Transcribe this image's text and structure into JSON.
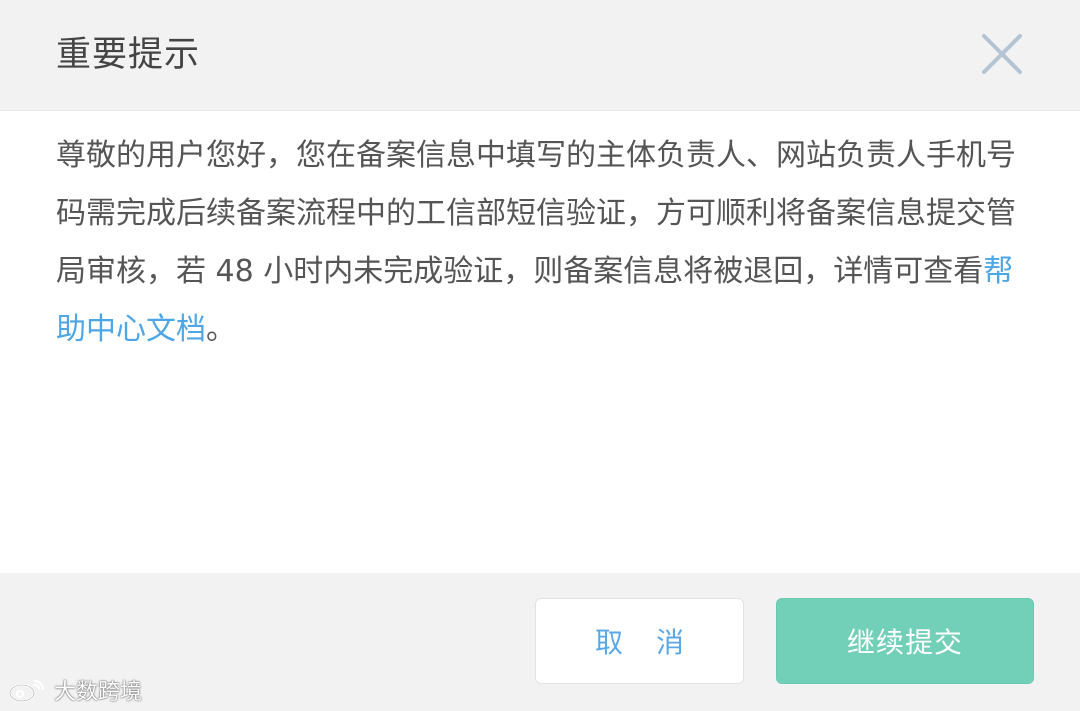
{
  "dialog": {
    "title": "重要提示",
    "close_icon": "close-icon",
    "message": {
      "text_before": "尊敬的用户您好，您在备案信息中填写的主体负责人、网站负责人手机号码需完成后续备案流程中的工信部短信验证，方可顺利将备案信息提交管局审核，若 48 小时内未完成验证，则备案信息将被退回，详情可查看",
      "link_text": "帮助中心文档",
      "text_after": "。"
    },
    "buttons": {
      "cancel_label": "取 消",
      "submit_label": "继续提交"
    }
  },
  "watermark": {
    "text": "大数跨境",
    "icon": "weibo-logo-icon"
  },
  "colors": {
    "header_bg": "#f2f2f2",
    "body_bg": "#ffffff",
    "link": "#4da6e6",
    "cancel_text": "#5aa9e6",
    "submit_bg": "#72cfb8",
    "close_icon": "#b5c4d4"
  }
}
